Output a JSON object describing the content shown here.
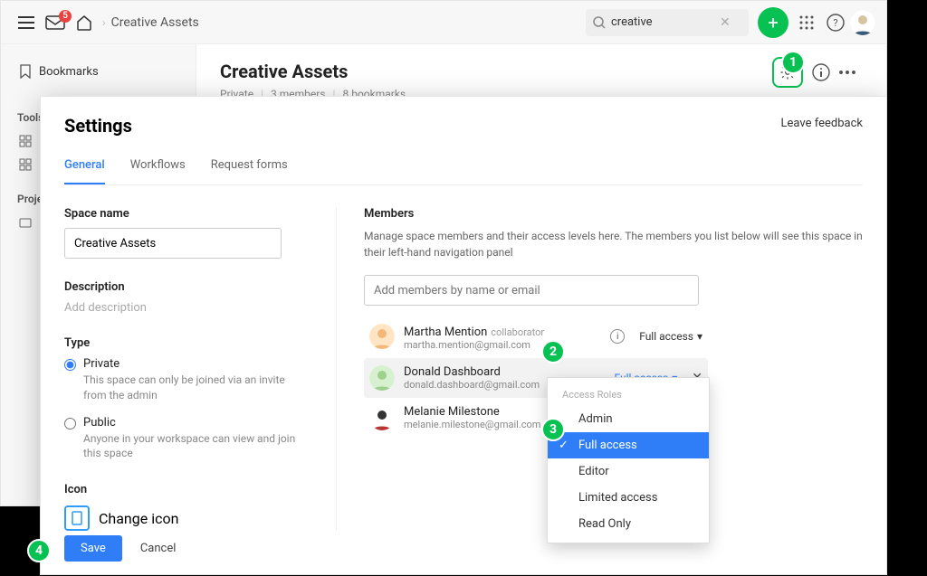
{
  "topbar": {
    "mail_count": "5",
    "breadcrumb": "Creative Assets",
    "search_value": "creative"
  },
  "leftnav": {
    "bookmarks": "Bookmarks",
    "tools_header": "Tools",
    "projects_header": "Projects"
  },
  "page": {
    "title": "Creative Assets",
    "meta": {
      "privacy": "Private",
      "members": "3 members",
      "bookmarks": "8 bookmarks"
    }
  },
  "settings": {
    "title": "Settings",
    "leave_feedback": "Leave feedback",
    "tabs": {
      "general": "General",
      "workflows": "Workflows",
      "requests": "Request forms"
    },
    "space_name_label": "Space name",
    "space_name_value": "Creative Assets",
    "description_label": "Description",
    "description_placeholder": "Add description",
    "type_label": "Type",
    "type_private": {
      "title": "Private",
      "desc": "This space can only be joined via an invite from the admin"
    },
    "type_public": {
      "title": "Public",
      "desc": "Anyone in your workspace can view and join this space"
    },
    "icon_label": "Icon",
    "change_icon": "Change icon",
    "members_label": "Members",
    "members_desc": "Manage space members and their access levels here. The members you list below will see this space in their left-hand navigation panel",
    "add_members_placeholder": "Add members by name or email",
    "members": [
      {
        "name": "Martha Mention",
        "tag": "collaborator",
        "email": "martha.mention@gmail.com",
        "access": "Full access"
      },
      {
        "name": "Donald Dashboard",
        "tag": "",
        "email": "donald.dashboard@gmail.com",
        "access": "Full access"
      },
      {
        "name": "Melanie Milestone",
        "tag": "",
        "email": "melanie.milestone@gmail.com",
        "access": ""
      }
    ],
    "dropdown": {
      "header": "Access Roles",
      "items": [
        "Admin",
        "Full access",
        "Editor",
        "Limited access",
        "Read Only"
      ],
      "selected": "Full access"
    },
    "save": "Save",
    "cancel": "Cancel"
  },
  "steps": {
    "s1": "1",
    "s2": "2",
    "s3": "3",
    "s4": "4"
  }
}
